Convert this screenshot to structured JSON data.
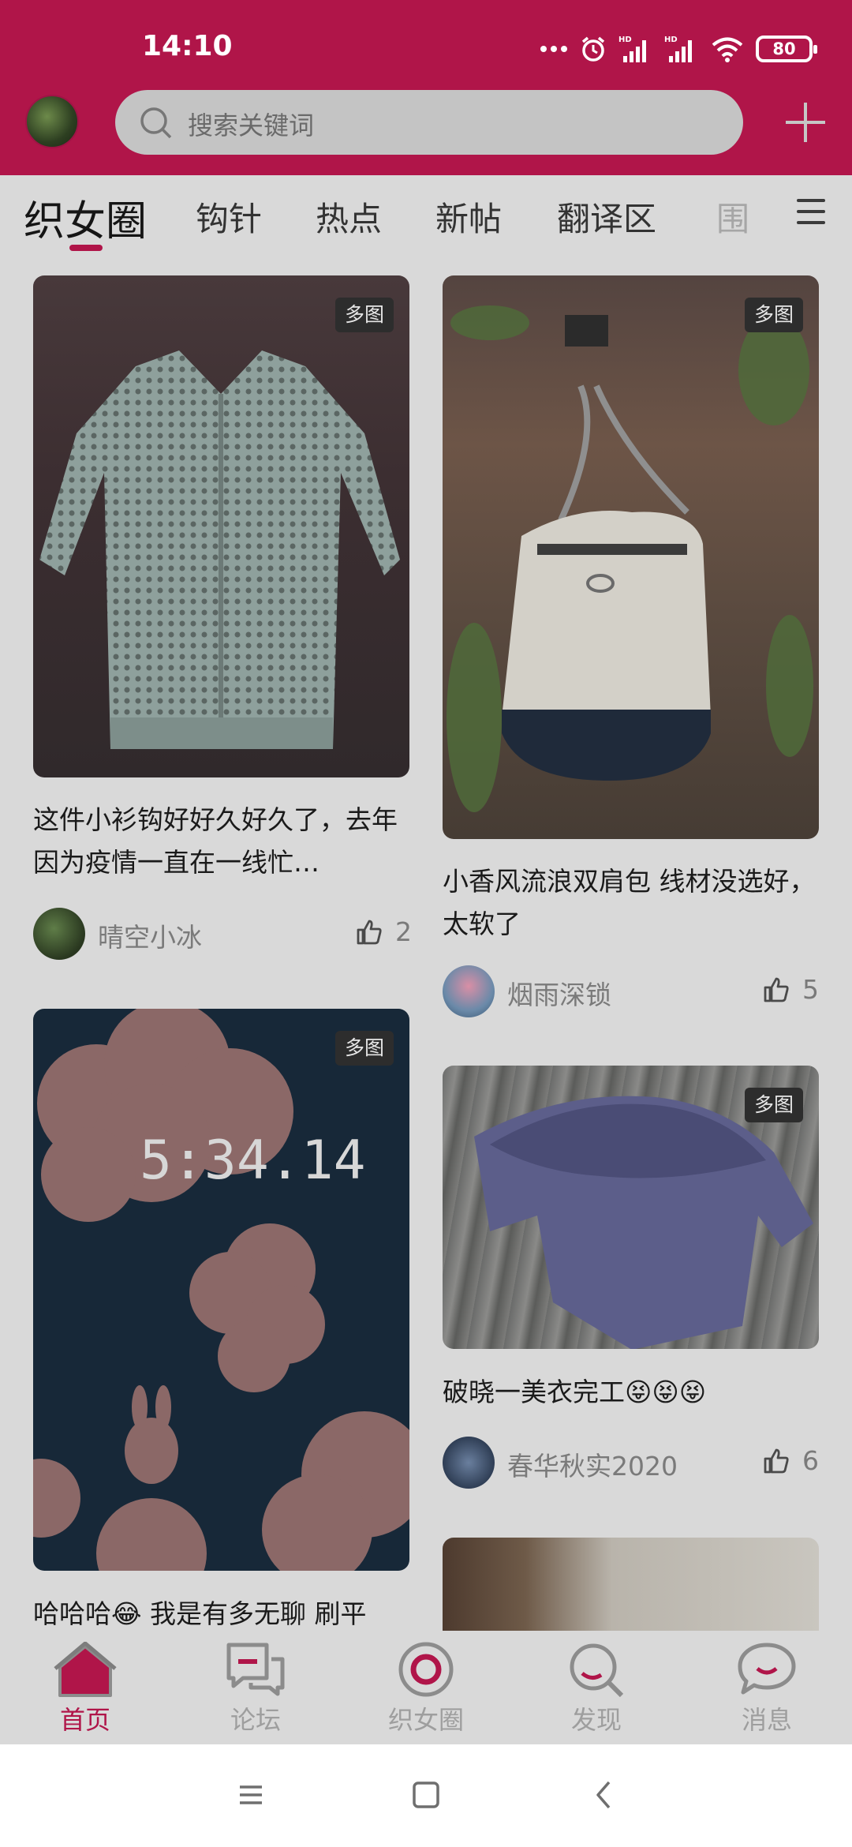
{
  "status_bar": {
    "time": "14:10",
    "battery": "80",
    "icons": [
      "more-dots-icon",
      "alarm-icon",
      "hd-signal-icon",
      "hd-signal-icon",
      "wifi-icon",
      "battery-icon"
    ]
  },
  "header": {
    "search_placeholder": "搜索关键词",
    "accent_color": "#b01549"
  },
  "tabs": [
    {
      "label": "织女圈",
      "active": true
    },
    {
      "label": "钩针"
    },
    {
      "label": "热点"
    },
    {
      "label": "新帖"
    },
    {
      "label": "翻译区"
    },
    {
      "label": "围"
    }
  ],
  "posts": [
    {
      "title": "这件小衫钩好好久好久了，去年因为疫情一直在一线忙…",
      "author": "晴空小冰",
      "likes": "2",
      "badge": "多图"
    },
    {
      "title": "小香风流浪双肩包 线材没选好，太软了",
      "author": "烟雨深锁",
      "likes": "5",
      "badge": "多图"
    },
    {
      "title": "哈哈哈😂 我是有多无聊 刷平",
      "badge": "多图",
      "image_text": "5:34.14"
    },
    {
      "title": "破晓一美衣完工😝😝😝",
      "author": "春华秋实2020",
      "likes": "6",
      "badge": "多图"
    }
  ],
  "bottom_nav": [
    {
      "label": "首页",
      "icon": "home-icon",
      "active": true
    },
    {
      "label": "论坛",
      "icon": "chat-bubbles-icon"
    },
    {
      "label": "织女圈",
      "icon": "circle-icon"
    },
    {
      "label": "发现",
      "icon": "search-icon"
    },
    {
      "label": "消息",
      "icon": "message-icon"
    }
  ]
}
